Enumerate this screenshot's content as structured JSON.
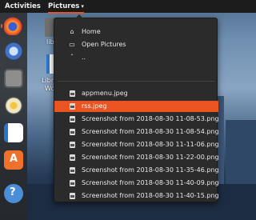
{
  "topbar": {
    "activities": "Activities",
    "app_menu": "Pictures",
    "app_menu_arrow": "▾"
  },
  "desktop": {
    "items": [
      {
        "label": "lib"
      },
      {
        "label": "Libre"
      },
      {
        "label": "Wo"
      }
    ]
  },
  "menu": {
    "places": [
      {
        "label": "Home",
        "icon": "home-icon",
        "glyph": "⌂"
      },
      {
        "label": "Open Pictures",
        "icon": "folder-icon",
        "glyph": "▭"
      },
      {
        "label": "..",
        "icon": "chevron-up-icon",
        "glyph": "ˆ"
      }
    ],
    "files": [
      "appmenu.jpeg",
      "rss.jpeg",
      "Screenshot from 2018-08-30 11-08-53.png",
      "Screenshot from 2018-08-30 11-08-54.png",
      "Screenshot from 2018-08-30 11-11-06.png",
      "Screenshot from 2018-08-30 11-22-00.png",
      "Screenshot from 2018-08-30 11-35-46.png",
      "Screenshot from 2018-08-30 11-40-09.png",
      "Screenshot from 2018-08-30 11-40-15.png"
    ],
    "selected_file": "rss.jpeg"
  },
  "colors": {
    "accent": "#e95420",
    "menu_bg": "#2b2b2b",
    "panel_bg": "#1c1c1c"
  }
}
